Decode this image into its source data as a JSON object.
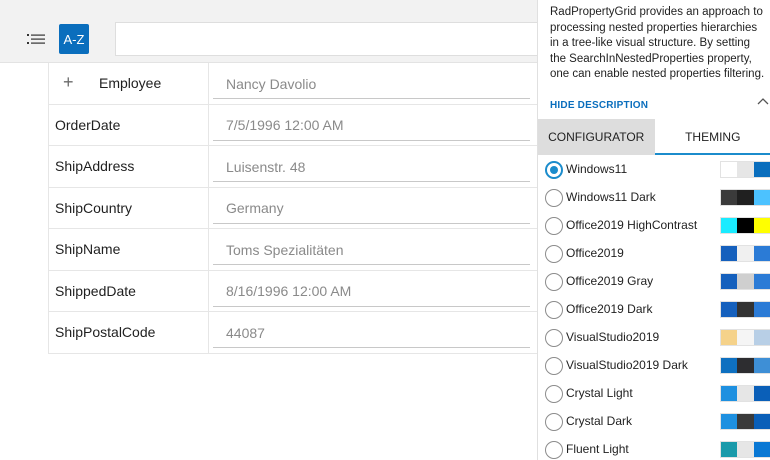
{
  "toolbar": {
    "categorize_icon": "list-icon",
    "sort_label": "A-Z",
    "search_value": ""
  },
  "properties": [
    {
      "name": "Employee",
      "value": "Nancy Davolio",
      "expandable": true,
      "expander": "+"
    },
    {
      "name": "OrderDate",
      "value": "7/5/1996 12:00 AM"
    },
    {
      "name": "ShipAddress",
      "value": "Luisenstr. 48"
    },
    {
      "name": "ShipCountry",
      "value": "Germany"
    },
    {
      "name": "ShipName",
      "value": "Toms Spezialitäten"
    },
    {
      "name": "ShippedDate",
      "value": "8/16/1996 12:00 AM"
    },
    {
      "name": "ShipPostalCode",
      "value": "44087"
    }
  ],
  "panel": {
    "description": "RadPropertyGrid provides an approach to processing nested properties hierarchies in a tree-like visual structure. By setting the SearchInNestedProperties property, one can enable nested properties filtering.",
    "hide_description": "HIDE DESCRIPTION",
    "tabs": [
      {
        "label": "CONFIGURATOR",
        "active": false
      },
      {
        "label": "THEMING",
        "active": true
      }
    ],
    "themes": [
      {
        "name": "Windows11",
        "selected": true,
        "colors": [
          "#ffffff",
          "#e6e6e6",
          "#0a6ebd"
        ]
      },
      {
        "name": "Windows11 Dark",
        "selected": false,
        "colors": [
          "#3b3b3b",
          "#202020",
          "#4cc2ff"
        ]
      },
      {
        "name": "Office2019 HighContrast",
        "selected": false,
        "colors": [
          "#1aebff",
          "#000000",
          "#ffff00"
        ]
      },
      {
        "name": "Office2019",
        "selected": false,
        "colors": [
          "#1560bd",
          "#f0f0f0",
          "#2b7bd6"
        ]
      },
      {
        "name": "Office2019 Gray",
        "selected": false,
        "colors": [
          "#1560bd",
          "#cfcfcf",
          "#2b7bd6"
        ]
      },
      {
        "name": "Office2019 Dark",
        "selected": false,
        "colors": [
          "#1560bd",
          "#333333",
          "#2b7bd6"
        ]
      },
      {
        "name": "VisualStudio2019",
        "selected": false,
        "colors": [
          "#f5d28a",
          "#f5f5f5",
          "#b8cfe6"
        ]
      },
      {
        "name": "VisualStudio2019 Dark",
        "selected": false,
        "colors": [
          "#0e70c0",
          "#2d2d30",
          "#3e8fd6"
        ]
      },
      {
        "name": "Crystal Light",
        "selected": false,
        "colors": [
          "#1e90e0",
          "#e6e6e6",
          "#0a5fb8"
        ]
      },
      {
        "name": "Crystal Dark",
        "selected": false,
        "colors": [
          "#1e90e0",
          "#3a3a3a",
          "#0a5fb8"
        ]
      },
      {
        "name": "Fluent Light",
        "selected": false,
        "colors": [
          "#1a9aaa",
          "#e6e6e6",
          "#0a78d4"
        ]
      }
    ]
  },
  "colors": {
    "accent": "#0a6ebd",
    "selection": "#1b8ccc"
  }
}
